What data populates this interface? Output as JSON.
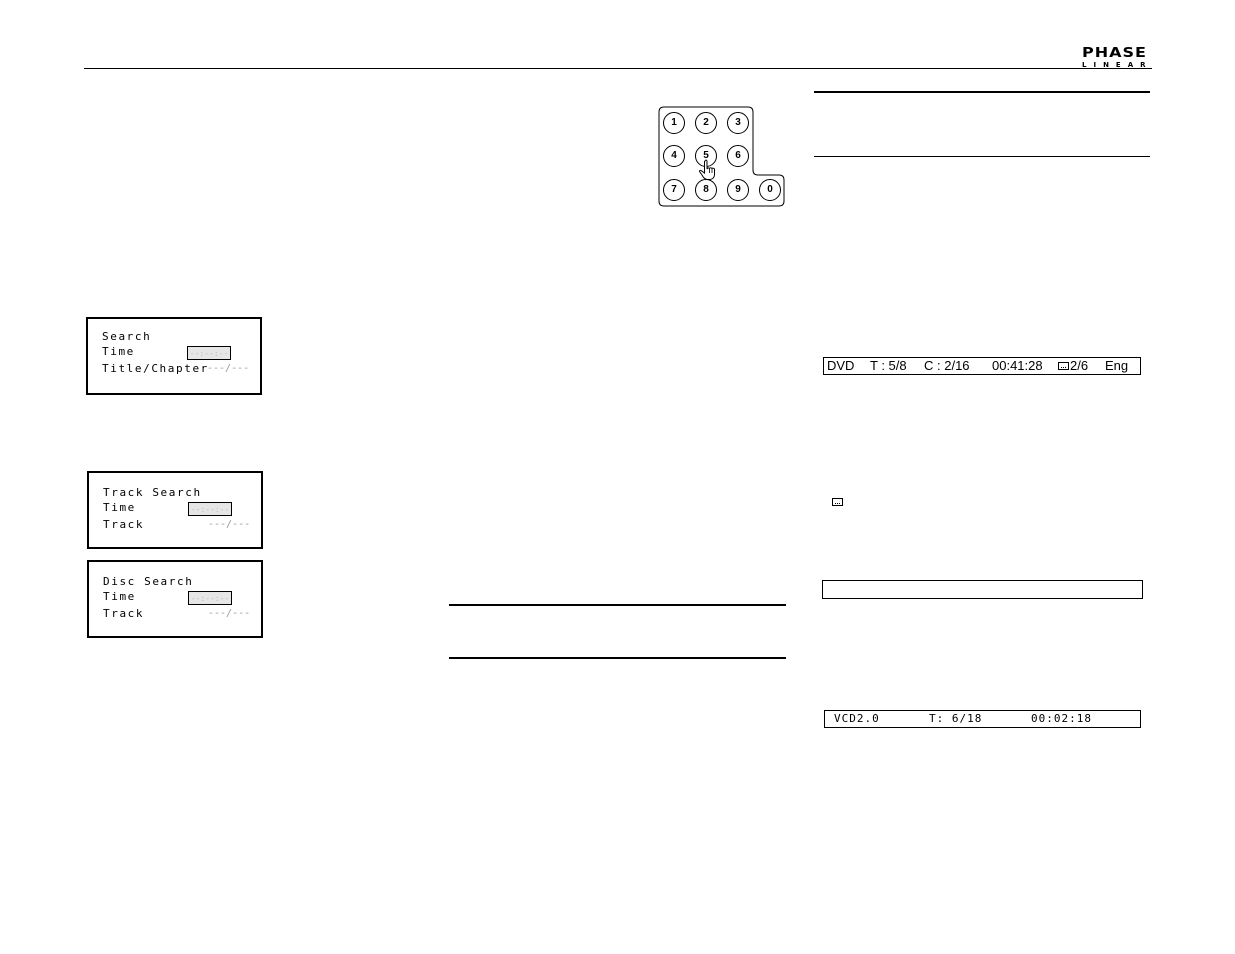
{
  "header": {
    "logo_top": "PHASE",
    "logo_bottom": "LINEAR"
  },
  "keypad": {
    "keys": [
      "1",
      "2",
      "3",
      "4",
      "5",
      "6",
      "7",
      "8",
      "9",
      "0"
    ],
    "pressed_key": "5",
    "pointer_icon": "hand-pointer-icon"
  },
  "osd_search": {
    "title": "Search",
    "time_label": "Time",
    "time_value": "--:--:--",
    "title_chapter_label": "Title/Chapter",
    "title_chapter_value": "---/---"
  },
  "osd_track_search": {
    "title": "Track Search",
    "time_label": "Time",
    "time_value": "--:--:--",
    "track_label": "Track",
    "track_value": "---/---"
  },
  "osd_disc_search": {
    "title": "Disc Search",
    "time_label": "Time",
    "time_value": "--:--:--",
    "track_label": "Track",
    "track_value": "---/---"
  },
  "dvd_bar": {
    "format": "DVD",
    "title": "T : 5/8",
    "chapter": "C : 2/16",
    "time": "00:41:28",
    "subtitle_icon": "subtitle-icon",
    "subtitle": "2/6",
    "language": "Eng"
  },
  "vcd_bar": {
    "format": "VCD2.0",
    "track": "T: 6/18",
    "time": "00:02:18"
  },
  "empty_bar": {
    "text": ""
  }
}
